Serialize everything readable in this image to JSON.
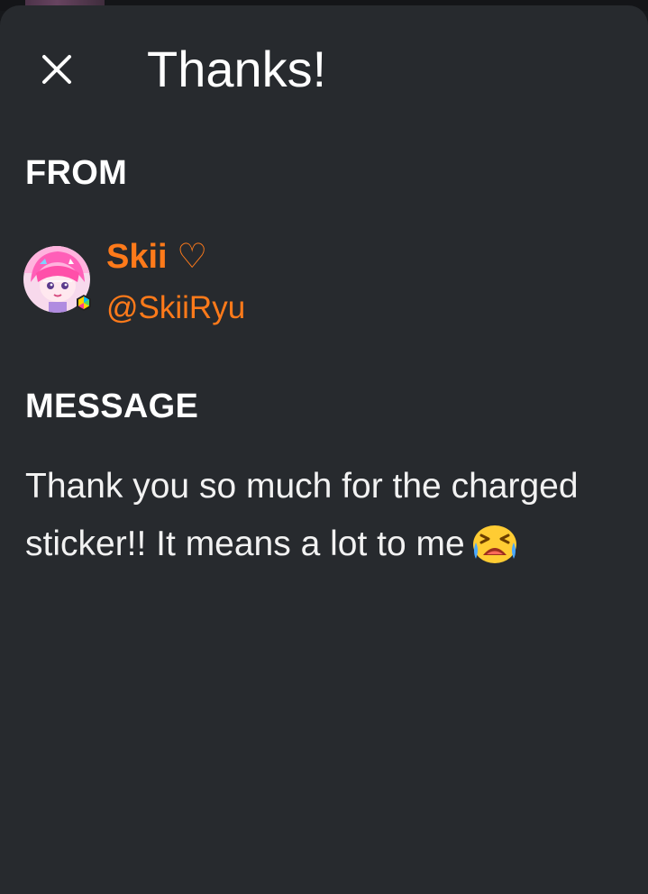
{
  "dialog": {
    "title": "Thanks!",
    "close_icon": "close-icon"
  },
  "from": {
    "heading": "FROM",
    "display_name": "Skii ♡",
    "handle": "@SkiiRyu",
    "name_color": "#ff7a1a"
  },
  "message": {
    "heading": "MESSAGE",
    "text": "Thank you so much for the charged sticker!! It means a lot to me",
    "emoji": "crying-face-emoji"
  },
  "colors": {
    "sheet_background": "#272a2e",
    "text": "#ffffff",
    "accent": "#ff7a1a"
  }
}
